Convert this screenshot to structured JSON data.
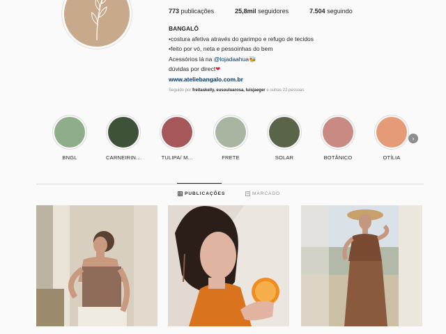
{
  "profile": {
    "stats": {
      "posts_count": "773",
      "posts_label": "publicações",
      "followers_count": "25,8mil",
      "followers_label": "seguidores",
      "following_count": "7.504",
      "following_label": "seguindo"
    },
    "name": "BANGALÔ",
    "bio_line1": "•costura afetiva através do garimpo e refugo de tecidos",
    "bio_line2": "•feito por vó, neta e pessoinhas do bem",
    "bio_line3_prefix": "Acessórios lá na ",
    "bio_line3_mention": "@lojadaahua",
    "bio_line3_emoji": "🐝",
    "bio_line4_prefix": "dúvidas por direct",
    "bio_line4_emoji": "❤",
    "website": "www.ateliebangalo.com.br",
    "followed_by_prefix": "Seguido por",
    "followed_by_users": "freitaskelly, eusouluarosa, luisjaeger",
    "followed_by_suffix": "e outras 22 pessoas"
  },
  "highlights": [
    {
      "label": "BNGL",
      "color": "#8fad8a"
    },
    {
      "label": "CARNEIRIN...",
      "color": "#3e5239"
    },
    {
      "label": "TULIPA/ M...",
      "color": "#a6575a"
    },
    {
      "label": "FRETE",
      "color": "#a9b5a0"
    },
    {
      "label": "SOLAR",
      "color": "#5a6448"
    },
    {
      "label": "BOTÂNICO",
      "color": "#c88a82"
    },
    {
      "label": "OTÍLIA",
      "color": "#e69b78"
    }
  ],
  "tabs": {
    "posts": "PUBLICAÇÕES",
    "tagged": "MARCADO"
  },
  "posts": [
    {
      "subject": "woman-brown-top-photo"
    },
    {
      "subject": "woman-orange-sweater-photo"
    },
    {
      "subject": "woman-brown-dress-hat-photo"
    }
  ]
}
